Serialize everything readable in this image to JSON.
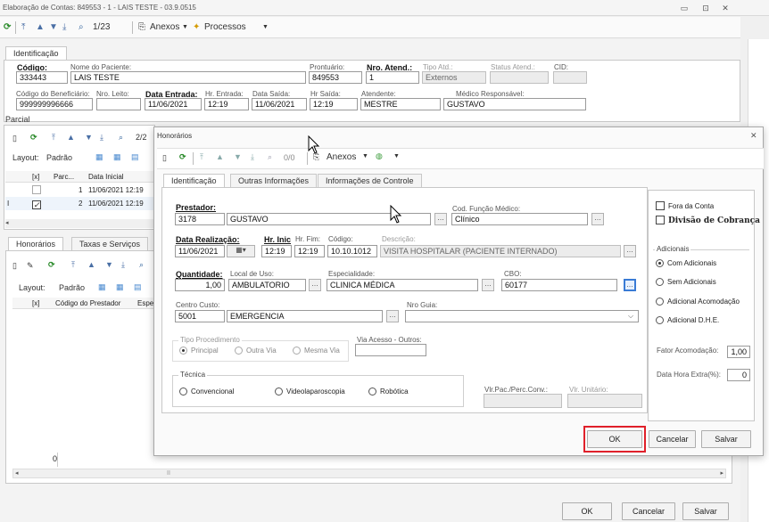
{
  "window_title": "Elaboração de Contas: 849553 - 1 - LAIS TESTE - 03.9.0515",
  "toolbar": {
    "counter": "1/23",
    "anexos": "Anexos",
    "processos": "Processos"
  },
  "tabs": {
    "identificacao": "Identificação"
  },
  "ident": {
    "codigo_label": "Código:",
    "codigo": "333443",
    "nome_label": "Nome do Paciente:",
    "nome": "LAIS TESTE",
    "prontuario_label": "Prontuário:",
    "prontuario": "849553",
    "nro_atend_label": "Nro. Atend.:",
    "nro_atend": "1",
    "tipo_atd_label": "Tipo Atd.:",
    "tipo_atd": "Externos",
    "status_label": "Status Atend.:",
    "cid_label": "CID:",
    "cod_benef_label": "Código do Beneficiário:",
    "cod_benef": "999999996666",
    "nro_leito_label": "Nro. Leito:",
    "data_entrada_label": "Data Entrada:",
    "data_entrada": "11/06/2021",
    "hr_entrada_label": "Hr. Entrada:",
    "hr_entrada": "12:19",
    "data_saida_label": "Data Saída:",
    "data_saida": "11/06/2021",
    "hr_saida_label": "Hr Saída:",
    "hr_saida": "12:19",
    "atendente_label": "Atendente:",
    "atendente": "MESTRE",
    "medico_label": "Médico Responsável:",
    "medico": "GUSTAVO"
  },
  "parcial": {
    "label": "Parcial",
    "counter": "2/2",
    "layout": "Layout:",
    "padrao": "Padrão",
    "columns": [
      "[x]",
      "Parc...",
      "Data Inicial"
    ],
    "rows": [
      {
        "parc": "1",
        "data": "11/06/2021 12:19"
      },
      {
        "parc": "2",
        "data": "11/06/2021 12:19"
      }
    ]
  },
  "lower": {
    "tab_honorarios": "Honorários",
    "tab_taxas": "Taxas e Serviços",
    "layout": "Layout:",
    "padrao": "Padrão",
    "columns": [
      "[x]",
      "Código do Prestador",
      "Espe"
    ],
    "footer_count": "0"
  },
  "bottom_buttons": {
    "ok": "OK",
    "cancelar": "Cancelar",
    "salvar": "Salvar"
  },
  "dialog": {
    "title": "Honorários",
    "counter": "0/0",
    "anexos": "Anexos",
    "tabs": [
      "Identificação",
      "Outras Informações",
      "Informações de Controle"
    ],
    "prestador_label": "Prestador:",
    "prestador_code": "3178",
    "prestador_name": "GUSTAVO",
    "cod_funcao_label": "Cod. Função Médico:",
    "cod_funcao": "Clínico",
    "data_realizacao_label": "Data Realização:",
    "data_realizacao": "11/06/2021",
    "hr_inic_label": "Hr. Inic",
    "hr_inic": "12:19",
    "hr_fim_label": "Hr. Fim:",
    "hr_fim": "12:19",
    "codigo_label": "Código:",
    "codigo": "10.10.1012",
    "descricao_label": "Descrição:",
    "descricao": "VISITA HOSPITALAR (PACIENTE INTERNADO)",
    "quantidade_label": "Quantidade:",
    "quantidade": "1,00",
    "local_uso_label": "Local de Uso:",
    "local_uso": "AMBULATORIO",
    "especialidade_label": "Especialidade:",
    "especialidade": "CLINICA MÉDICA",
    "cbo_label": "CBO:",
    "cbo": "60177",
    "centro_custo_label": "Centro Custo:",
    "centro_custo_code": "5001",
    "centro_custo_name": "EMERGENCIA",
    "nro_guia_label": "Nro Guia:",
    "tipo_proc_label": "Tipo Procedimento",
    "tipo_proc": [
      "Principal",
      "Outra Via",
      "Mesma Via"
    ],
    "via_acesso_label": "Via Acesso - Outros:",
    "tecnica_label": "Técnica",
    "tecnica": [
      "Convencional",
      "Videolaparoscopia",
      "Robótica"
    ],
    "vlr_pac_label": "Vlr.Pac./Perc.Conv.:",
    "vlr_unit_label": "Vlr. Unitário:",
    "fora_conta": "Fora da Conta",
    "divisao_cobranca": "Divisão de Cobrança",
    "adicionais_label": "Adicionais",
    "adicionais": [
      "Com Adicionais",
      "Sem Adicionais",
      "Adicional Acomodação",
      "Adicional D.H.E."
    ],
    "fator_label": "Fator Acomodação:",
    "fator": "1,00",
    "data_hora_extra_label": "Data Hora Extra(%):",
    "data_hora_extra": "0",
    "ok": "OK",
    "cancelar": "Cancelar",
    "salvar": "Salvar"
  }
}
